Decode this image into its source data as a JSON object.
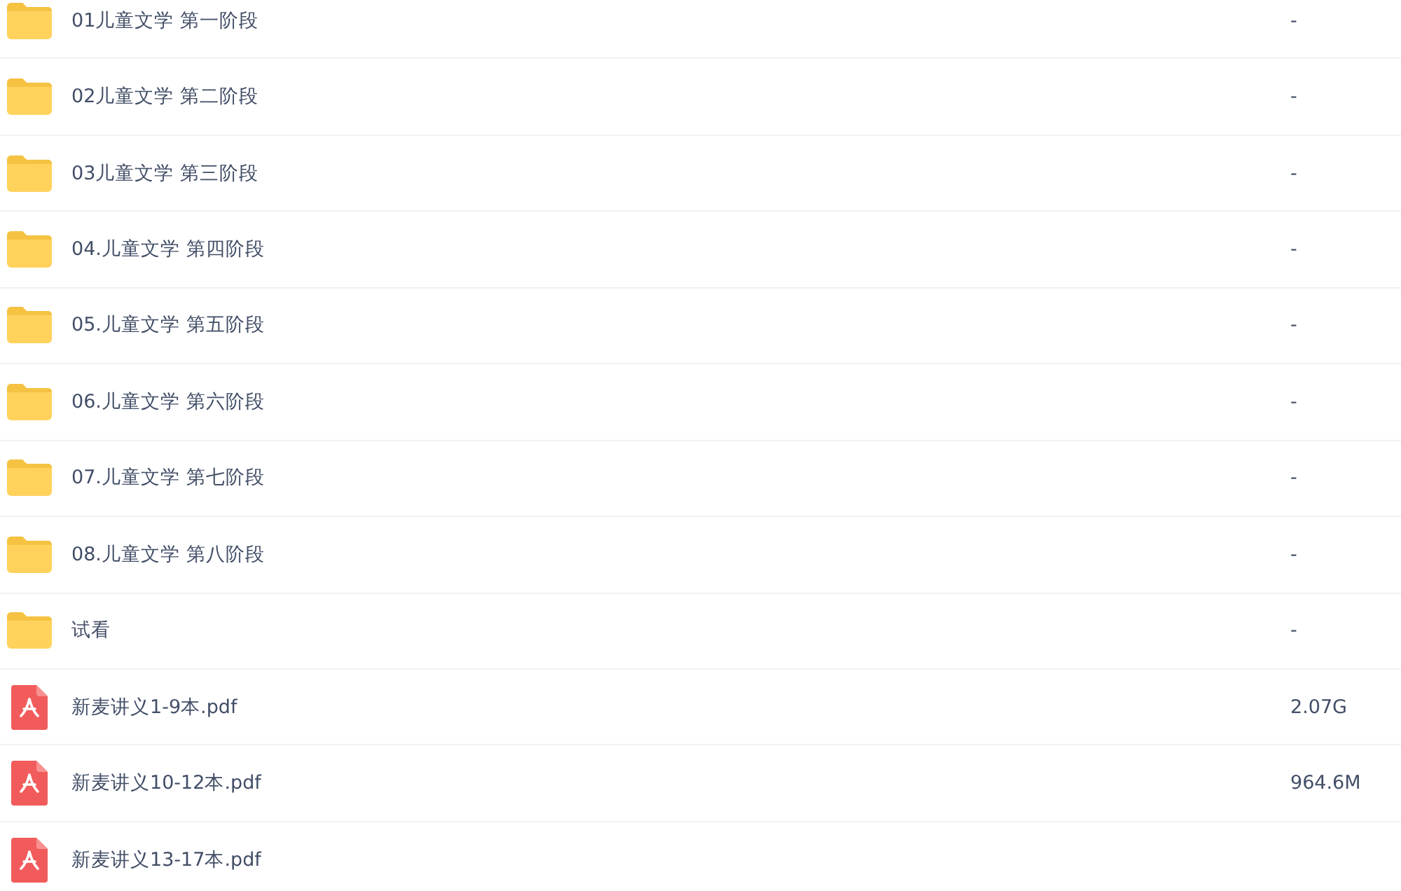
{
  "files": [
    {
      "kind": "folder",
      "name": "01儿童文学 第一阶段",
      "size": "-"
    },
    {
      "kind": "folder",
      "name": "02儿童文学 第二阶段",
      "size": "-"
    },
    {
      "kind": "folder",
      "name": "03儿童文学 第三阶段",
      "size": "-"
    },
    {
      "kind": "folder",
      "name": "04.儿童文学 第四阶段",
      "size": "-"
    },
    {
      "kind": "folder",
      "name": "05.儿童文学 第五阶段",
      "size": "-"
    },
    {
      "kind": "folder",
      "name": "06.儿童文学 第六阶段",
      "size": "-"
    },
    {
      "kind": "folder",
      "name": "07.儿童文学 第七阶段",
      "size": "-"
    },
    {
      "kind": "folder",
      "name": "08.儿童文学 第八阶段",
      "size": "-"
    },
    {
      "kind": "folder",
      "name": "试看",
      "size": "-"
    },
    {
      "kind": "pdf",
      "name": "新麦讲义1-9本.pdf",
      "size": "2.07G"
    },
    {
      "kind": "pdf",
      "name": "新麦讲义10-12本.pdf",
      "size": "964.6M"
    },
    {
      "kind": "pdf",
      "name": "新麦讲义13-17本.pdf"
    }
  ]
}
